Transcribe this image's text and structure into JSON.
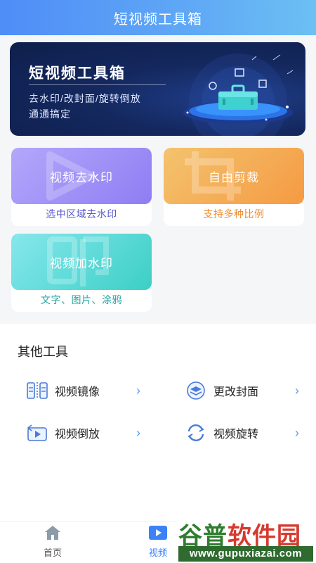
{
  "header": {
    "title": "短视频工具箱"
  },
  "banner": {
    "title": "短视频工具箱",
    "subtitle_line1": "去水印/改封面/旋转倒放",
    "subtitle_line2": "通通搞定",
    "art_icon": "toolbox-illustration"
  },
  "cards": [
    {
      "title": "视频去水印",
      "subtitle": "选中区域去水印",
      "deco_icon": "play-icon"
    },
    {
      "title": "自由剪裁",
      "subtitle": "支持多种比例",
      "deco_icon": "crop-icon"
    },
    {
      "title": "视频加水印",
      "subtitle": "文字、图片、涂鸦",
      "deco_icon": "stamp-icon"
    }
  ],
  "other_tools": {
    "title": "其他工具",
    "items": [
      {
        "label": "视频镜像",
        "icon": "mirror-icon"
      },
      {
        "label": "更改封面",
        "icon": "layers-icon"
      },
      {
        "label": "视频倒放",
        "icon": "reverse-play-icon"
      },
      {
        "label": "视频旋转",
        "icon": "rotate-icon"
      }
    ],
    "chevron": "›"
  },
  "tabbar": {
    "tabs": [
      {
        "label": "首页",
        "icon": "home-icon"
      },
      {
        "label": "视频",
        "icon": "video-icon",
        "active": true
      }
    ]
  },
  "watermark": {
    "brand_green": "谷普",
    "brand_red": "软件园",
    "url": "www.gupuxiazai.com"
  },
  "colors": {
    "header": "#5fa8f6",
    "accent": "#3b82f6",
    "card_purple": "#8f7df3",
    "card_orange": "#f59a43",
    "card_teal": "#3ccfc6"
  }
}
